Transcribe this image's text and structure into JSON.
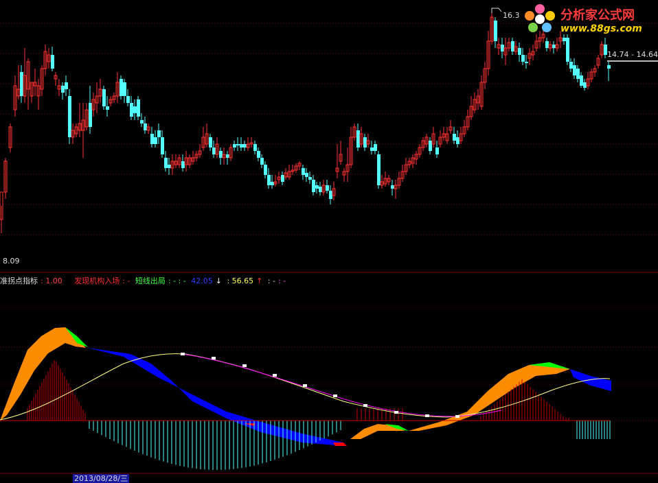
{
  "price_panel": {
    "high_marker": "16.3",
    "low_marker": "8.09",
    "current_price_label": "14.74 - 14.64"
  },
  "logo": {
    "name": "分析家公式网",
    "url": "www.88gs.com"
  },
  "indicator_bar": {
    "name": "准拐点指标",
    "value": ": 1.00",
    "buy_label": "发现机构入场",
    "buy_value": ": -",
    "sell_label": "短线出局",
    "sell_value": ": - : -",
    "down_value": "42.05",
    "down_arrow": "↓",
    "up_value": ": 56.65",
    "up_arrow": "↑",
    "tail1": ": -",
    "tail2": ": -"
  },
  "axis_bottom": {
    "date_label": "2013/08/28/三"
  },
  "colors": {
    "up_candle": "#ff3232",
    "down_candle": "#54ffff",
    "orange_band": "#ff8c00",
    "blue_band": "#0000ff",
    "green_accent": "#00ff00",
    "red_accent": "#ff0000",
    "yellow_line": "#ffff80",
    "magenta_line": "#ff00ff",
    "hist_pos": "#c80000",
    "hist_neg": "#54ffff",
    "grid": "#7a0000"
  }
}
